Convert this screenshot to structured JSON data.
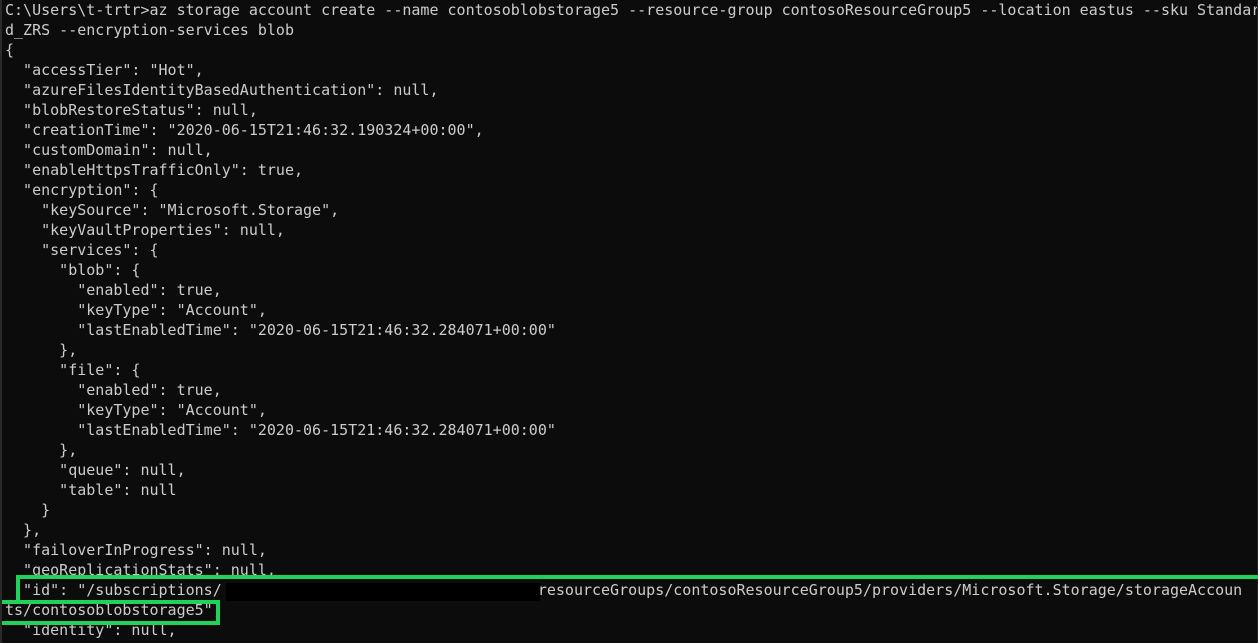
{
  "window": {
    "app_name": "command-prompt",
    "background_color": "#0c0c0c",
    "foreground_color": "#cccccc",
    "highlight_color": "#21d25a",
    "redaction_color": "#000000"
  },
  "prompt": {
    "path": "C:\\Users\\t-trtr",
    "symbol": ">",
    "command": "az storage account create --name contosoblobstorage5 --resource-group contosoResourceGroup5 --location eastus --sku Standard_ZRS --encryption-services blob"
  },
  "console": {
    "lines": [
      "C:\\Users\\t-trtr>az storage account create --name contosoblobstorage5 --resource-group contosoResourceGroup5 --location eastus --sku Standar",
      "d_ZRS --encryption-services blob",
      "{",
      "  \"accessTier\": \"Hot\",",
      "  \"azureFilesIdentityBasedAuthentication\": null,",
      "  \"blobRestoreStatus\": null,",
      "  \"creationTime\": \"2020-06-15T21:46:32.190324+00:00\",",
      "  \"customDomain\": null,",
      "  \"enableHttpsTrafficOnly\": true,",
      "  \"encryption\": {",
      "    \"keySource\": \"Microsoft.Storage\",",
      "    \"keyVaultProperties\": null,",
      "    \"services\": {",
      "      \"blob\": {",
      "        \"enabled\": true,",
      "        \"keyType\": \"Account\",",
      "        \"lastEnabledTime\": \"2020-06-15T21:46:32.284071+00:00\"",
      "      },",
      "      \"file\": {",
      "        \"enabled\": true,",
      "        \"keyType\": \"Account\",",
      "        \"lastEnabledTime\": \"2020-06-15T21:46:32.284071+00:00\"",
      "      },",
      "      \"queue\": null,",
      "      \"table\": null",
      "    }",
      "  },",
      "  \"failoverInProgress\": null,",
      "  \"geoReplicationStats\": null,",
      "  \"id\": \"/subscriptions/                                  /resourceGroups/contosoResourceGroup5/providers/Microsoft.Storage/storageAccoun",
      "ts/contosoblobstorage5\",",
      "  \"identity\": null,"
    ]
  },
  "highlight": {
    "label": "resource-id-highlight",
    "target_key": "id",
    "value_line_1": "\"id\": \"/subscriptions/",
    "value_line_1_tail": "/resourceGroups/contosoResourceGroup5/providers/Microsoft.Storage/storageAccoun",
    "value_line_2": "ts/contosoblobstorage5\"",
    "color": "#21d25a"
  },
  "redaction": {
    "label": "subscription-id-redaction",
    "description": "blacked out subscription GUID"
  }
}
